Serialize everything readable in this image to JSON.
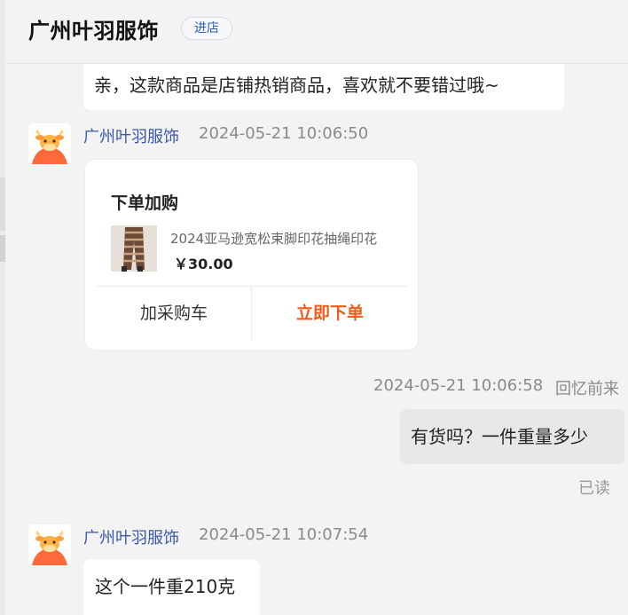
{
  "header": {
    "shop_name": "广州叶羽服饰",
    "enter_label": "进店"
  },
  "messages": {
    "top_text": "亲，这款商品是店铺热销商品，喜欢就不要错过哦~",
    "seller_name": "广州叶羽服饰",
    "card_time": "2024-05-21 10:06:50",
    "card": {
      "title": "下单加购",
      "product_name": "2024亚马逊宽松束脚印花抽绳印花",
      "price": "￥30.00",
      "cart_label": "加采购车",
      "order_label": "立即下单"
    },
    "my_time": "2024-05-21 10:06:58",
    "my_name": "回忆前来",
    "my_text": "有货吗？一件重量多少",
    "read_status": "已读",
    "reply_seller_name": "广州叶羽服饰",
    "reply_time": "2024-05-21 10:07:54",
    "reply_text": "这个一件重210克"
  },
  "colors": {
    "accent_order": "#f05a1a",
    "seller_name": "#3b57a9",
    "avatar": "#ff7a45"
  },
  "icons": {
    "avatar": "cow-mascot-avatar-icon"
  }
}
